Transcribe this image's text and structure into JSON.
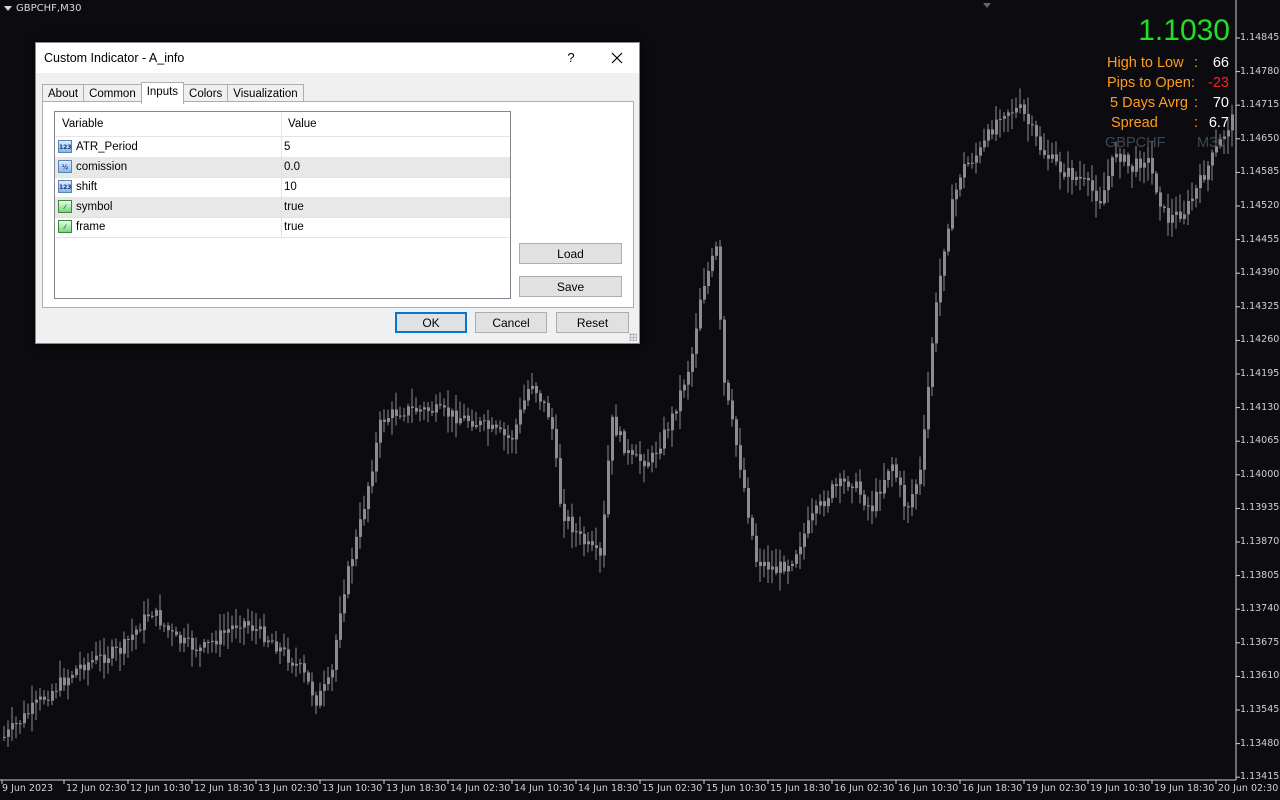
{
  "chart": {
    "symbol_label": "GBPCHF,M30",
    "background": "#0b0b10",
    "candle_color": "#8c8c8c",
    "price_axis": [
      "1.14845",
      "1.14780",
      "1.14715",
      "1.14650",
      "1.14585",
      "1.14520",
      "1.14455",
      "1.14390",
      "1.14325",
      "1.14260",
      "1.14195",
      "1.14130",
      "1.14065",
      "1.14000",
      "1.13935",
      "1.13870",
      "1.13805",
      "1.13740",
      "1.13675",
      "1.13610",
      "1.13545",
      "1.13480",
      "1.13415"
    ],
    "time_axis": [
      "9 Jun 2023",
      "12 Jun 02:30",
      "12 Jun 10:30",
      "12 Jun 18:30",
      "13 Jun 02:30",
      "13 Jun 10:30",
      "13 Jun 18:30",
      "14 Jun 02:30",
      "14 Jun 10:30",
      "14 Jun 18:30",
      "15 Jun 02:30",
      "15 Jun 10:30",
      "15 Jun 18:30",
      "16 Jun 02:30",
      "16 Jun 10:30",
      "16 Jun 18:30",
      "19 Jun 02:30",
      "19 Jun 10:30",
      "19 Jun 18:30",
      "20 Jun 02:30"
    ]
  },
  "info_panel": {
    "price": "1.1030",
    "price_color": "#22e022",
    "label_color": "#ff9e1a",
    "rows": [
      {
        "label": "High to Low",
        "sep": ":",
        "value": "66",
        "value_color": "#ffffff"
      },
      {
        "label": "Pips to Open:",
        "sep": "",
        "value": "-23",
        "value_color": "#ff2020"
      },
      {
        "label": "5 Days Avrg",
        "sep": ":",
        "value": "70",
        "value_color": "#ffffff"
      },
      {
        "label": "Spread",
        "sep": ":",
        "value": "6.7",
        "value_color": "#ffffff"
      }
    ],
    "footer": {
      "left": "GBPCHF",
      "right": "M30",
      "color": "#3c4a55"
    }
  },
  "dialog": {
    "title": "Custom Indicator - A_info",
    "help_label": "?",
    "close_icon": "close-icon",
    "tabs": [
      "About",
      "Common",
      "Inputs",
      "Colors",
      "Visualization"
    ],
    "active_tab": "Inputs",
    "columns": {
      "variable": "Variable",
      "value": "Value"
    },
    "inputs": [
      {
        "name": "ATR_Period",
        "value": "5",
        "icon": "int-icon",
        "icon_text": "123"
      },
      {
        "name": "comission",
        "value": "0.0",
        "icon": "double-icon",
        "icon_text": "½"
      },
      {
        "name": "shift",
        "value": "10",
        "icon": "int-icon",
        "icon_text": "123"
      },
      {
        "name": "symbol",
        "value": "true",
        "icon": "bool-icon",
        "icon_text": "⁄"
      },
      {
        "name": "frame",
        "value": "true",
        "icon": "bool-icon",
        "icon_text": "⁄"
      }
    ],
    "buttons": {
      "load": "Load",
      "save": "Save",
      "ok": "OK",
      "cancel": "Cancel",
      "reset": "Reset"
    }
  }
}
